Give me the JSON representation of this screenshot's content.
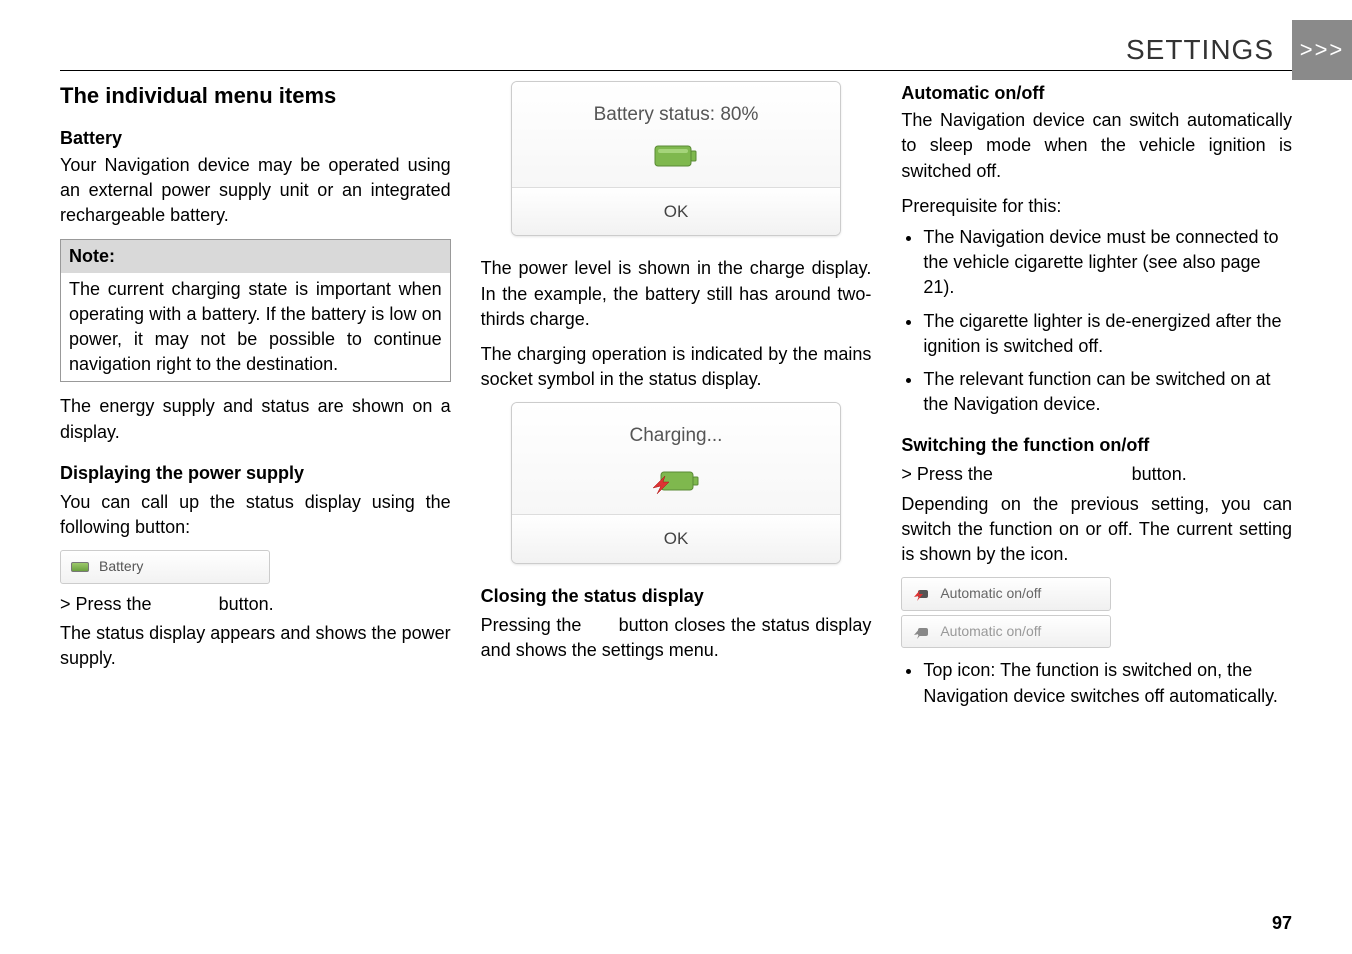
{
  "header": {
    "title": "SETTINGS",
    "chevrons": ">>>"
  },
  "col1": {
    "section_title": "The individual menu items",
    "battery_head": "Battery",
    "battery_para": "Your Navigation device may be operated using an external power supply unit or an integrated rechargeable battery.",
    "note_label": "Note:",
    "note_body": "The current charging state is important when operating with a battery. If the battery is low on power, it may not be possible to continue navigation right to the destination.",
    "energy_para": "The energy supply and status are shown on a display.",
    "disp_head": "Displaying the power supply",
    "disp_para": "You can call up the status display using the following button:",
    "battery_btn_label": "Battery",
    "press_prefix": "> Press the ",
    "press_suffix": " button.",
    "status_para": "The status display appears and shows the power supply."
  },
  "col2": {
    "dialog1_title": "Battery status: 80%",
    "dialog_ok": "OK",
    "power_para": "The power level is shown in the charge display. In the example, the battery still has around two-thirds charge.",
    "charging_para": "The charging operation is indicated by the mains socket symbol in the status display.",
    "dialog2_title": "Charging...",
    "closing_head": "Closing the status display",
    "closing_para_pre": "Pressing the ",
    "closing_para_post": " button closes the status display and shows the settings menu."
  },
  "col3": {
    "auto_head": "Automatic on/off",
    "auto_para1": "The Navigation device can switch automatically to sleep mode when the vehicle ignition is switched off.",
    "prereq": "Prerequisite for this:",
    "bullets": [
      "The Navigation device must be connected to the vehicle cigarette lighter (see also page 21).",
      "The cigarette lighter is de-energized after the ignition is switched off.",
      "The relevant function can be switched on at the Navigation device."
    ],
    "switch_head": "Switching the function on/off",
    "press_prefix": "> Press the ",
    "press_suffix": " button.",
    "depending_para": "Depending on the previous setting, you can switch the function on or off. The current setting is shown by the icon.",
    "auto_btn_label": "Automatic on/off",
    "top_icon_bullet": "Top icon: The function is switched on, the Navigation device switches off automatically."
  },
  "page_number": "97"
}
